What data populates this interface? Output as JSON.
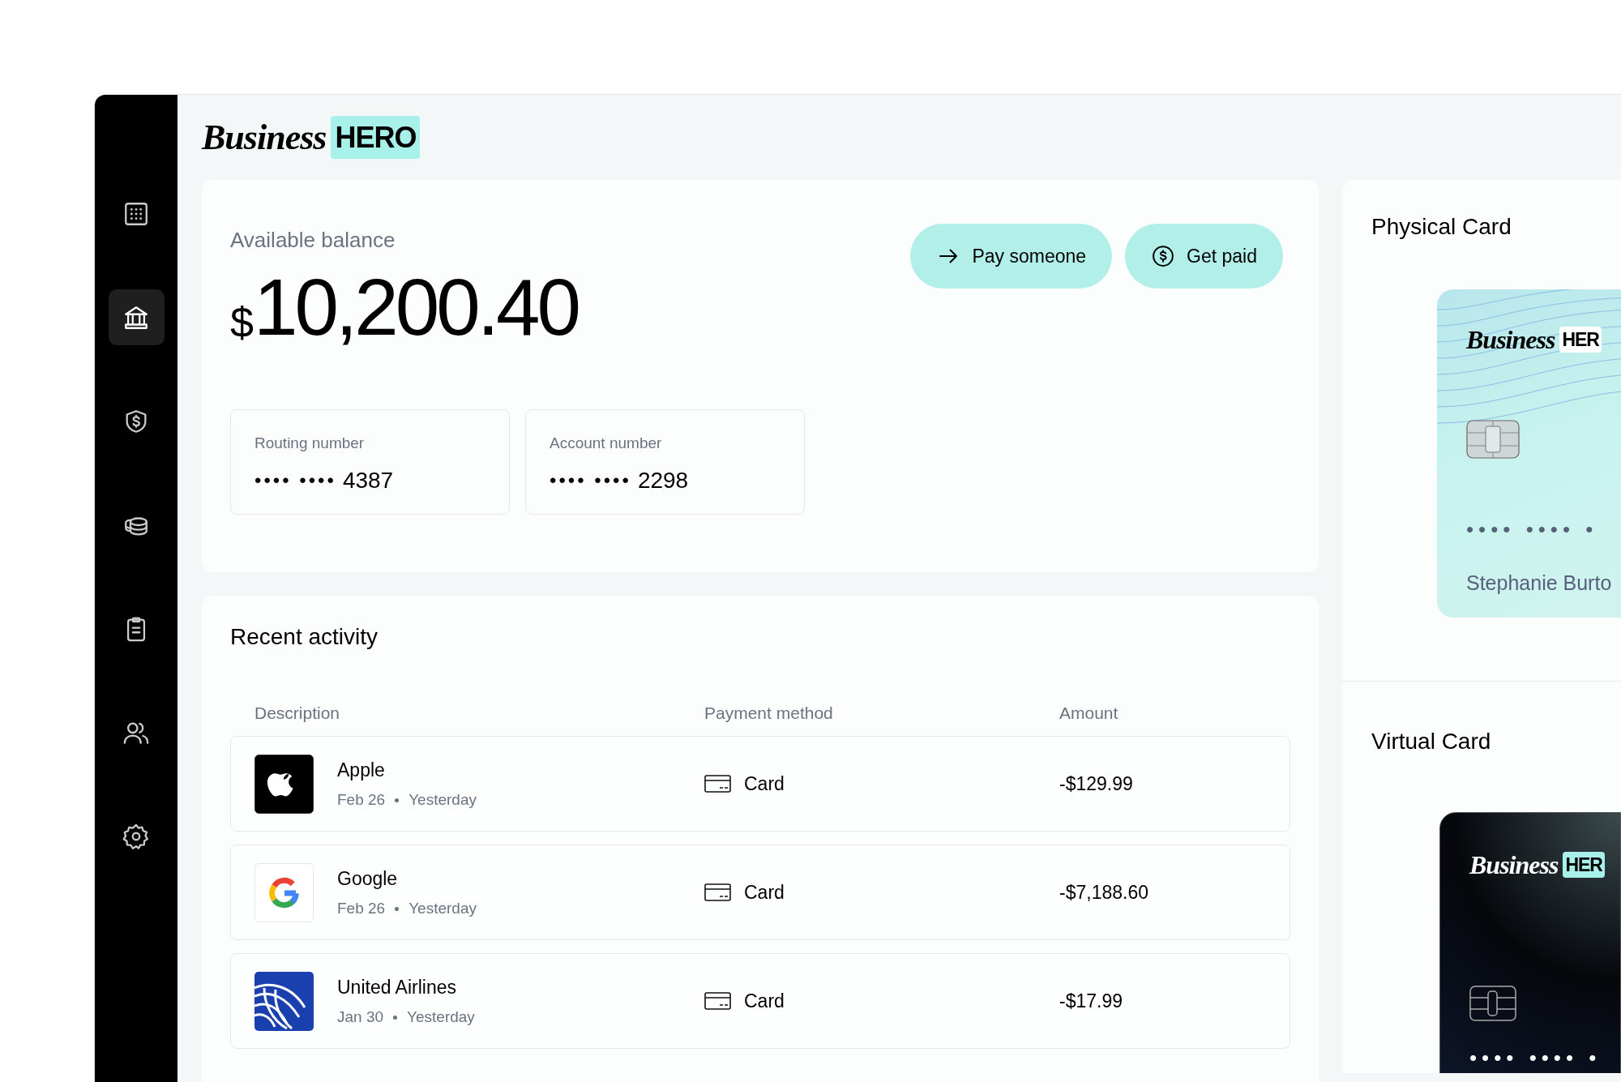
{
  "logo": {
    "script": "Business",
    "badge": "HERO"
  },
  "sidebar": {
    "items": [
      {
        "kind": "grid",
        "selected": false
      },
      {
        "kind": "bank",
        "selected": true
      },
      {
        "kind": "shield",
        "selected": false
      },
      {
        "kind": "coins",
        "selected": false
      },
      {
        "kind": "clipboard",
        "selected": false
      },
      {
        "kind": "users",
        "selected": false
      },
      {
        "kind": "settings",
        "selected": false
      }
    ]
  },
  "balance": {
    "label": "Available balance",
    "currency": "$",
    "amount": "10,200.40"
  },
  "actions": [
    {
      "kind": "pay",
      "label": "Pay someone"
    },
    {
      "kind": "receive",
      "label": "Get paid"
    }
  ],
  "accounts": [
    {
      "label": "Routing number",
      "masked": "•••• ••••",
      "last4": "4387"
    },
    {
      "label": "Account number",
      "masked": "•••• ••••",
      "last4": "2298"
    }
  ],
  "activity": {
    "title": "Recent activity",
    "columns": [
      "Description",
      "Payment method",
      "Amount"
    ],
    "rows": [
      {
        "kind": "apple",
        "name": "Apple",
        "date": "Feb 26",
        "when": "Yesterday",
        "method": "Card",
        "amount": "-$129.99"
      },
      {
        "kind": "google",
        "name": "Google",
        "date": "Feb 26",
        "when": "Yesterday",
        "method": "Card",
        "amount": "-$7,188.60"
      },
      {
        "kind": "united",
        "name": "United Airlines",
        "date": "Jan 30",
        "when": "Yesterday",
        "method": "Card",
        "amount": "-$17.99"
      }
    ]
  },
  "cards": [
    {
      "kind": "physical",
      "title": "Physical Card",
      "script": "Business",
      "badge": "HER",
      "number": "•••• •••• •",
      "holder": "Stephanie Burto"
    },
    {
      "kind": "virtual",
      "title": "Virtual Card",
      "script": "Business",
      "badge": "HER",
      "number": "•••• •••• •"
    }
  ]
}
